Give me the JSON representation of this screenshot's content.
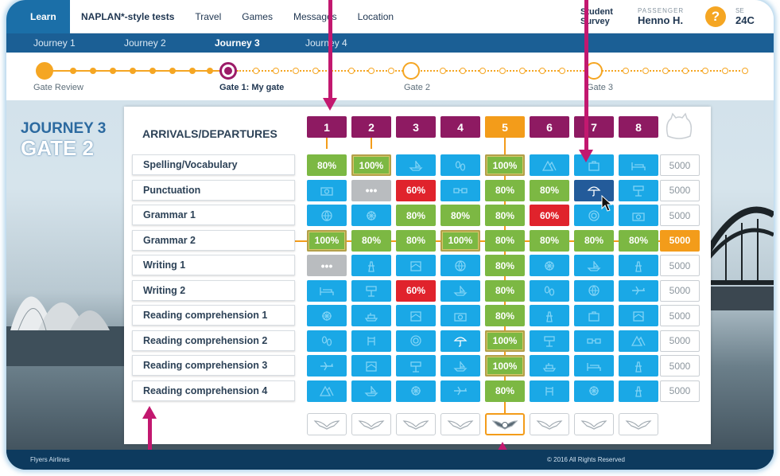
{
  "topnav": {
    "learn": "Learn",
    "items": [
      "NAPLAN*-style tests",
      "Travel",
      "Games",
      "Messages",
      "Location"
    ],
    "survey": "Student Survey",
    "passenger_label": "PASSENGER",
    "passenger_name": "Henno H.",
    "help": "?",
    "seat_label": "SE",
    "seat_value": "24C"
  },
  "journey_tabs": [
    "Journey 1",
    "Journey 2",
    "Journey 3",
    "Journey 4"
  ],
  "active_journey_index": 2,
  "progress": {
    "labels": [
      "Gate Review",
      "Gate 1: My gate",
      "Gate 2",
      "Gate 3"
    ]
  },
  "heading": {
    "journey": "JOURNEY 3",
    "gate": "GATE 2"
  },
  "board": {
    "title": "ARRIVALS/DEPARTURES",
    "columns": [
      "1",
      "2",
      "3",
      "4",
      "5",
      "6",
      "7",
      "8"
    ],
    "active_column_index": 4,
    "active_row_index": 3,
    "rows": [
      {
        "label": "Spelling/Vocabulary",
        "score": "5000",
        "cells": [
          [
            "green",
            "80%"
          ],
          [
            "green-gold",
            "100%"
          ],
          [
            "blue",
            "boat-icon"
          ],
          [
            "blue",
            "footprints-icon"
          ],
          [
            "green-gold",
            "100%"
          ],
          [
            "blue",
            "mountain-icon"
          ],
          [
            "blue",
            "suitcase-icon"
          ],
          [
            "blue",
            "bed-icon"
          ]
        ]
      },
      {
        "label": "Punctuation",
        "score": "5000",
        "cells": [
          [
            "blue",
            "camera-icon"
          ],
          [
            "grey",
            "•••"
          ],
          [
            "red",
            "60%"
          ],
          [
            "blue",
            "glasses-icon"
          ],
          [
            "green",
            "80%"
          ],
          [
            "green",
            "80%"
          ],
          [
            "navy",
            "umbrella-icon"
          ],
          [
            "blue",
            "sign-icon"
          ]
        ]
      },
      {
        "label": "Grammar 1",
        "score": "5000",
        "cells": [
          [
            "blue",
            "globe-icon"
          ],
          [
            "blue",
            "wheel-icon"
          ],
          [
            "green",
            "80%"
          ],
          [
            "green",
            "80%"
          ],
          [
            "green",
            "80%"
          ],
          [
            "red",
            "60%"
          ],
          [
            "blue",
            "lifebuoy-icon"
          ],
          [
            "blue",
            "camera-icon"
          ]
        ]
      },
      {
        "label": "Grammar 2",
        "score": "5000",
        "cells": [
          [
            "green-gold",
            "100%"
          ],
          [
            "green",
            "80%"
          ],
          [
            "green",
            "80%"
          ],
          [
            "green-gold",
            "100%"
          ],
          [
            "green",
            "80%"
          ],
          [
            "green",
            "80%"
          ],
          [
            "green",
            "80%"
          ],
          [
            "green",
            "80%"
          ]
        ]
      },
      {
        "label": "Writing 1",
        "score": "5000",
        "cells": [
          [
            "grey",
            "•••"
          ],
          [
            "blue",
            "tower-icon"
          ],
          [
            "blue",
            "map-icon"
          ],
          [
            "blue",
            "globe-icon"
          ],
          [
            "green",
            "80%"
          ],
          [
            "blue",
            "wheel-icon"
          ],
          [
            "blue",
            "boat-icon"
          ],
          [
            "blue",
            "tower-icon"
          ]
        ]
      },
      {
        "label": "Writing 2",
        "score": "5000",
        "cells": [
          [
            "blue",
            "bed-icon"
          ],
          [
            "blue",
            "sign-icon"
          ],
          [
            "red",
            "60%"
          ],
          [
            "blue",
            "boat-icon"
          ],
          [
            "green",
            "80%"
          ],
          [
            "blue",
            "footprints-icon"
          ],
          [
            "blue",
            "globe-icon"
          ],
          [
            "blue",
            "plane-icon"
          ]
        ]
      },
      {
        "label": "Reading comprehension 1",
        "score": "5000",
        "cells": [
          [
            "blue",
            "wheel-icon"
          ],
          [
            "blue",
            "ship-icon"
          ],
          [
            "blue",
            "map-icon"
          ],
          [
            "blue",
            "camera-icon"
          ],
          [
            "green",
            "80%"
          ],
          [
            "blue",
            "tower-icon"
          ],
          [
            "blue",
            "suitcase-icon"
          ],
          [
            "blue",
            "map-icon"
          ]
        ]
      },
      {
        "label": "Reading comprehension 2",
        "score": "5000",
        "cells": [
          [
            "blue",
            "footprints-icon"
          ],
          [
            "blue",
            "chair-icon"
          ],
          [
            "blue",
            "lifebuoy-icon"
          ],
          [
            "blue",
            "umbrella-icon"
          ],
          [
            "green-gold",
            "100%"
          ],
          [
            "blue",
            "sign-icon"
          ],
          [
            "blue",
            "glasses-icon"
          ],
          [
            "blue",
            "mountain-icon"
          ]
        ]
      },
      {
        "label": "Reading comprehension 3",
        "score": "5000",
        "cells": [
          [
            "blue",
            "plane-icon"
          ],
          [
            "blue",
            "map-icon"
          ],
          [
            "blue",
            "sign-icon"
          ],
          [
            "blue",
            "boat-icon"
          ],
          [
            "green-gold",
            "100%"
          ],
          [
            "blue",
            "ship-icon"
          ],
          [
            "blue",
            "bed-icon"
          ],
          [
            "blue",
            "tower-icon"
          ]
        ]
      },
      {
        "label": "Reading comprehension 4",
        "score": "5000",
        "cells": [
          [
            "blue",
            "mountain-icon"
          ],
          [
            "blue",
            "boat-icon"
          ],
          [
            "blue",
            "wheel-icon"
          ],
          [
            "blue",
            "plane-icon"
          ],
          [
            "green",
            "80%"
          ],
          [
            "blue",
            "chair-icon"
          ],
          [
            "blue",
            "wheel-icon"
          ],
          [
            "blue",
            "tower-icon"
          ]
        ]
      }
    ]
  },
  "footer": {
    "left": "Flyers Airlines",
    "right": "© 2016 All Rights Reserved"
  },
  "colors": {
    "accent": "#f39c1a",
    "purple": "#8e1a62",
    "green": "#7cb843",
    "red": "#e0232c",
    "blue": "#1aa8e6",
    "navy_nav": "#1b5f95"
  }
}
